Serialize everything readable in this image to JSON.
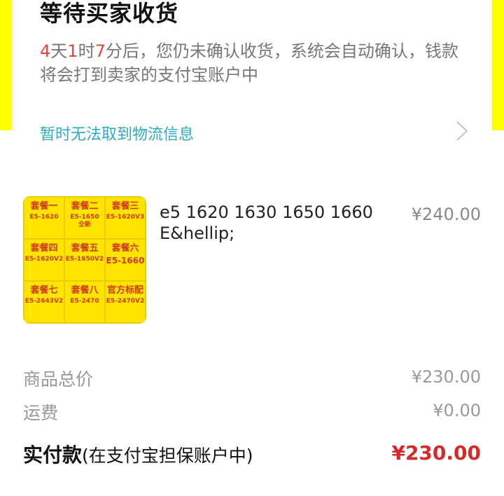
{
  "status": {
    "title": "等待买家收货",
    "countdown": {
      "days": "4",
      "days_unit": "天",
      "hours": "1",
      "hours_unit": "时",
      "minutes": "7",
      "minutes_unit": "分后，",
      "message": "您仍未确认收货，系统会自动确认，钱款将会打到卖家的支付宝账户中"
    }
  },
  "logistics": {
    "text": "暂时无法取到物流信息",
    "icon": "chevron-right-icon"
  },
  "product": {
    "name": "e5 1620 1630 1650 1660 E&hellip;",
    "price": "¥240.00",
    "thumbnail": [
      {
        "pkg": "套餐一",
        "model": "E5-1620",
        "extra": ""
      },
      {
        "pkg": "套餐二",
        "model": "E5-1650",
        "extra": "全新"
      },
      {
        "pkg": "套餐三",
        "model": "E5-1620V3",
        "extra": ""
      },
      {
        "pkg": "套餐四",
        "model": "E5-1620V2",
        "extra": ""
      },
      {
        "pkg": "套餐五",
        "model": "E5-1650V2",
        "extra": ""
      },
      {
        "pkg": "套餐六",
        "model": "E5-1660",
        "extra": ""
      },
      {
        "pkg": "套餐七",
        "model": "E5-2643V2",
        "extra": ""
      },
      {
        "pkg": "套餐八",
        "model": "E5-2470",
        "extra": ""
      },
      {
        "pkg": "官方标配",
        "model": "E5-2470V2",
        "extra": ""
      }
    ]
  },
  "summary": {
    "goods_total_label": "商品总价",
    "goods_total_value": "¥230.00",
    "shipping_label": "运费",
    "shipping_value": "¥0.00",
    "paid_label_strong": "实付款",
    "paid_label_note": "(在支付宝担保账户中)",
    "paid_value": "¥230.00"
  },
  "colors": {
    "accent_yellow": "#ffff00",
    "countdown_red": "#e0453a",
    "link_blue": "#2ea9c9",
    "price_red": "#d42a2a"
  }
}
